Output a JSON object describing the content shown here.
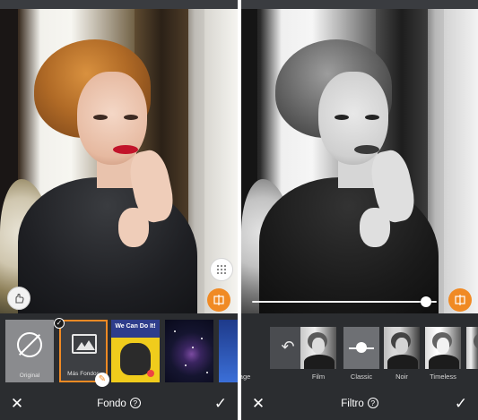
{
  "left_panel": {
    "title": "Fondo",
    "help_icon": "help-circle-icon",
    "close_icon": "close-icon",
    "confirm_icon": "checkmark-icon",
    "brush_icon": "brush-hand-icon",
    "options_icon": "dots-menu-icon",
    "compare_icon": "compare-split-icon",
    "backgrounds": [
      {
        "label": "Original",
        "icon": "no-background-icon"
      },
      {
        "label": "Más Fondos",
        "icon": "image-gallery-icon",
        "selected": true
      },
      {
        "label": "We Can Do It!",
        "kind": "poster"
      },
      {
        "label": "",
        "kind": "galaxy"
      },
      {
        "label": "",
        "kind": "blue"
      }
    ],
    "selected_badge_icon": "checkmark-icon",
    "edit_badge_icon": "pencil-icon"
  },
  "right_panel": {
    "title": "Filtro",
    "help_icon": "help-circle-icon",
    "close_icon": "close-icon",
    "confirm_icon": "checkmark-icon",
    "compare_icon": "compare-split-icon",
    "intensity": 0.97,
    "filters": [
      {
        "label": "",
        "icon": "undo-arrow-icon"
      },
      {
        "label": "Film"
      },
      {
        "label": "Classic",
        "selected": true
      },
      {
        "label": "Noir"
      },
      {
        "label": "Timeless"
      }
    ],
    "partial_left_label": "tage"
  },
  "colors": {
    "accent": "#f08a24",
    "bar_bg": "#2b2d30",
    "text": "#ffffff"
  }
}
